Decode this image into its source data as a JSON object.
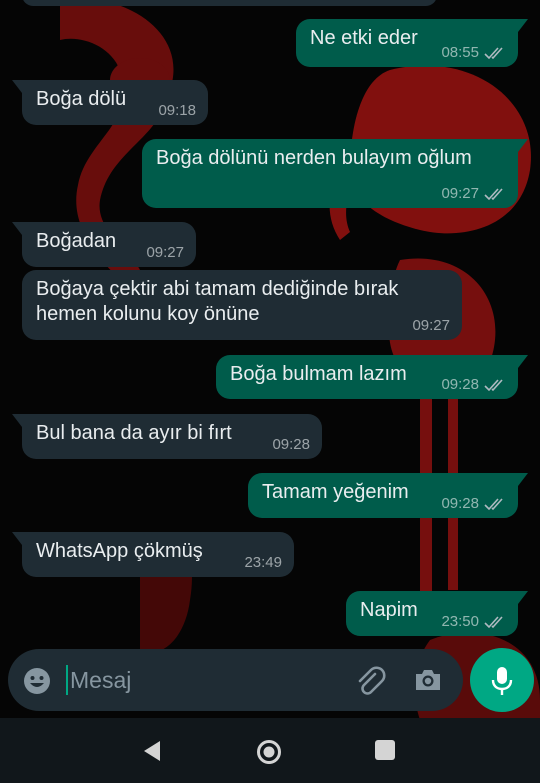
{
  "messages": [
    {
      "side": "out",
      "text": "Ne etki eder",
      "time": "08:55",
      "read": true
    },
    {
      "side": "in",
      "text": "Boğa dölü",
      "time": "09:18"
    },
    {
      "side": "out",
      "text": "Boğa dölünü nerden bulayım oğlum",
      "time": "09:27",
      "read": true
    },
    {
      "side": "in",
      "text": "Boğadan",
      "time": "09:27"
    },
    {
      "side": "in",
      "text": "Boğaya çektir abi tamam dediğinde bırak hemen kolunu koy önüne",
      "time": "09:27"
    },
    {
      "side": "out",
      "text": "Boğa bulmam lazım",
      "time": "09:28",
      "read": true
    },
    {
      "side": "in",
      "text": "Bul bana da ayır bi fırt",
      "time": "09:28"
    },
    {
      "side": "out",
      "text": "Tamam yeğenim",
      "time": "09:28",
      "read": true
    },
    {
      "side": "in",
      "text": "WhatsApp çökmüş",
      "time": "23:49"
    },
    {
      "side": "out",
      "text": "Napim",
      "time": "23:50",
      "read": true
    }
  ],
  "composer": {
    "placeholder": "Mesaj",
    "icons": [
      "emoji-icon",
      "attach-icon",
      "camera-icon",
      "mic-icon"
    ]
  },
  "colors": {
    "incoming_bubble": "#1f2c34",
    "outgoing_bubble": "#005c4b",
    "accent": "#00a884",
    "wallpaper_accent": "#a21412"
  },
  "navigation": {
    "icons": [
      "back-icon",
      "home-icon",
      "recents-icon"
    ]
  }
}
